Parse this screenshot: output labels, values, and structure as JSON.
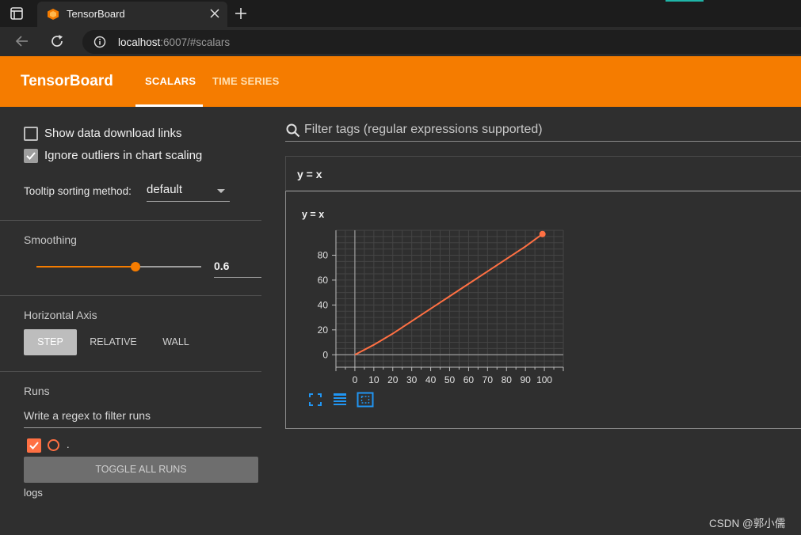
{
  "browser": {
    "tab_title": "TensorBoard",
    "url_host": "localhost",
    "url_rest": ":6007/#scalars"
  },
  "header": {
    "logo": "TensorBoard",
    "tabs": [
      {
        "label": "SCALARS",
        "active": true
      },
      {
        "label": "TIME SERIES",
        "active": false
      }
    ]
  },
  "sidebar": {
    "show_download_links": {
      "label": "Show data download links",
      "checked": false
    },
    "ignore_outliers": {
      "label": "Ignore outliers in chart scaling",
      "checked": true
    },
    "tooltip_sorting": {
      "label": "Tooltip sorting method:",
      "value": "default"
    },
    "smoothing": {
      "title": "Smoothing",
      "value": "0.6",
      "fraction": 0.6
    },
    "horizontal_axis": {
      "title": "Horizontal Axis",
      "options": [
        "STEP",
        "RELATIVE",
        "WALL"
      ],
      "selected": "STEP"
    },
    "runs": {
      "title": "Runs",
      "filter_placeholder": "Write a regex to filter runs",
      "items": [
        {
          "name": ".",
          "checked": true,
          "color": "#ff7043"
        }
      ],
      "toggle_label": "TOGGLE ALL RUNS",
      "logdir": "logs"
    }
  },
  "main": {
    "filter_placeholder": "Filter tags (regular expressions supported)",
    "card": {
      "title": "y = x"
    }
  },
  "chart_data": {
    "type": "line",
    "title": "y = x",
    "xlabel": "",
    "ylabel": "",
    "x_ticks": [
      0,
      10,
      20,
      30,
      40,
      50,
      60,
      70,
      80,
      90,
      100
    ],
    "y_ticks": [
      0,
      20,
      40,
      60,
      80
    ],
    "xlim": [
      -10,
      110
    ],
    "ylim": [
      -10,
      100
    ],
    "grid": true,
    "series": [
      {
        "color": "#ff7043",
        "x": [
          0,
          10,
          20,
          30,
          40,
          50,
          60,
          70,
          80,
          90,
          99
        ],
        "y": [
          0,
          8,
          17,
          27,
          37,
          47,
          57,
          67,
          77,
          87,
          97
        ]
      }
    ]
  },
  "colors": {
    "accent": "#f57c00",
    "run": "#ff7043",
    "icon_blue": "#2196f3"
  },
  "watermark": "CSDN @郭小儒"
}
